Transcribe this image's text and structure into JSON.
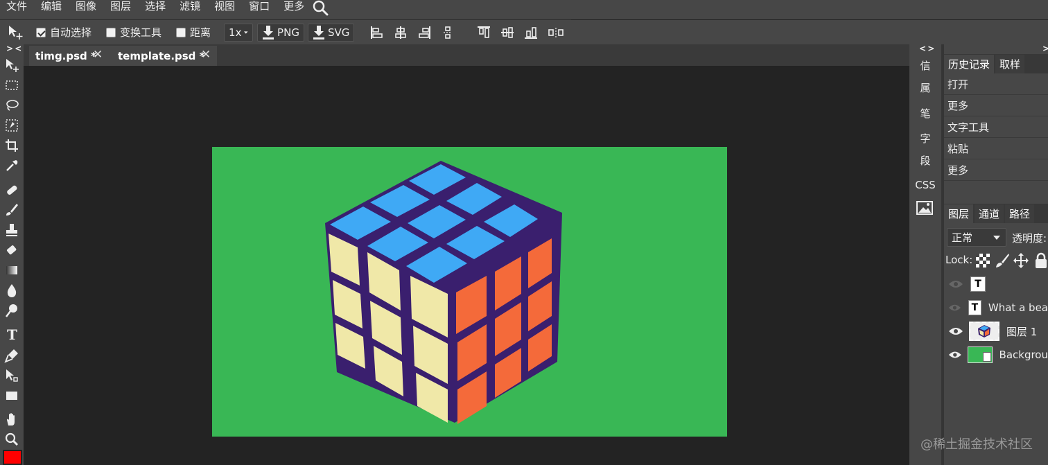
{
  "menu": {
    "items": [
      "文件",
      "编辑",
      "图像",
      "图层",
      "选择",
      "滤镜",
      "视图",
      "窗口",
      "更多"
    ],
    "search_icon": "search-icon"
  },
  "options": {
    "auto_select": {
      "label": "自动选择",
      "checked": true
    },
    "transform_tools": {
      "label": "变换工具",
      "checked": false
    },
    "distance": {
      "label": "距离",
      "checked": false
    },
    "zoom_select": "1x",
    "png_label": "PNG",
    "svg_label": "SVG"
  },
  "tabs": [
    {
      "label": "timg.psd *"
    },
    {
      "label": "template.psd *"
    }
  ],
  "tab_close_glyph": "✕",
  "collapse_left": "> <",
  "collapse_right": "< >",
  "side_labels": [
    "信",
    "属",
    "笔",
    "字",
    "段",
    "CSS"
  ],
  "history_panel": {
    "tabs": [
      "历史记录",
      "取样"
    ],
    "items": [
      "打开",
      "更多",
      "文字工具",
      "粘贴",
      "更多"
    ]
  },
  "layers_panel": {
    "tabs": [
      "图层",
      "通道",
      "路径"
    ],
    "blend_mode": "正常",
    "opacity_label": "透明度:",
    "lock_label": "Lock:",
    "layers": [
      {
        "name": "",
        "thumb": "T",
        "visible": false
      },
      {
        "name": "What a bea",
        "thumb": "T",
        "visible": false
      },
      {
        "name": "图层 1",
        "thumb": "image",
        "visible": true
      },
      {
        "name": "Backgrou",
        "thumb": "green",
        "visible": true
      }
    ]
  },
  "foreground_color": "#ff0000",
  "canvas_bg_color": "#39b755",
  "watermark": "@稀土掘金技术社区"
}
